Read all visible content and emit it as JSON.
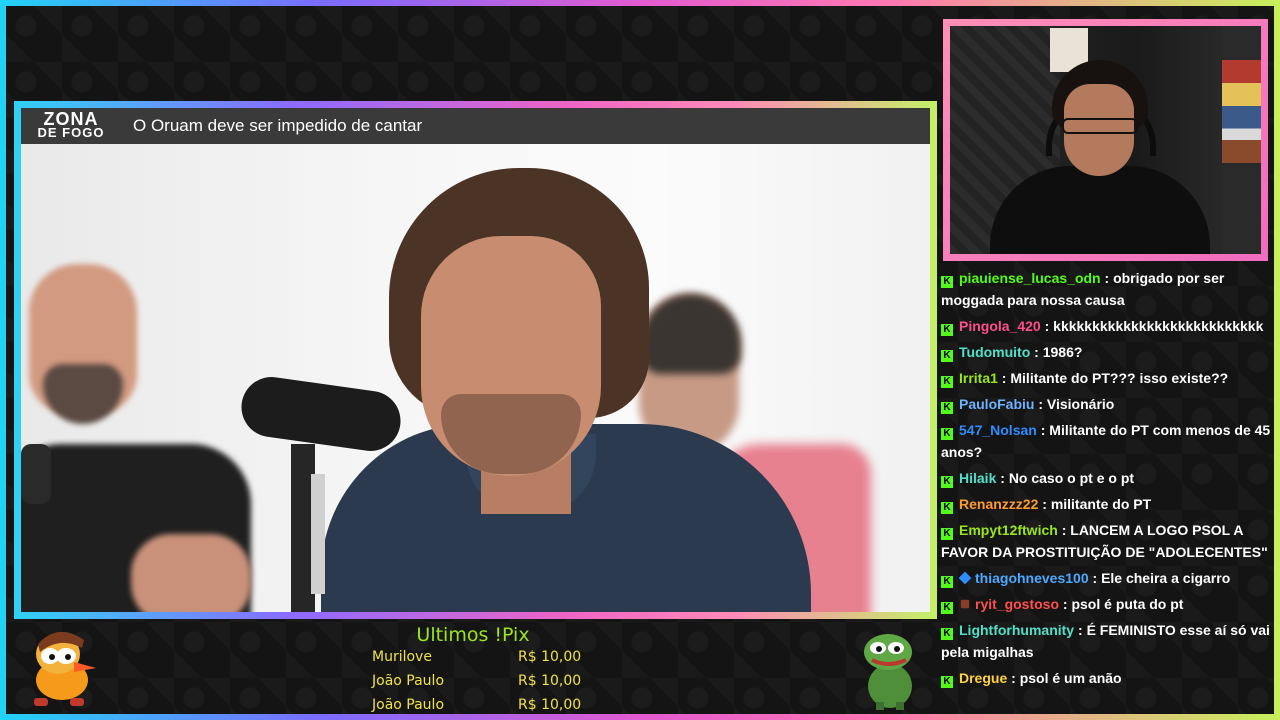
{
  "video": {
    "brand_line1": "ZONA",
    "brand_line2": "DE FOGO",
    "title": "O Oruam deve ser impedido de cantar"
  },
  "chat": {
    "messages": [
      {
        "user": "piauiense_lucas_odn",
        "user_color": "#53fc18",
        "badge_extra": null,
        "text": "obrigado por ser moggada para nossa causa"
      },
      {
        "user": "Pingola_420",
        "user_color": "#ff4f8b",
        "badge_extra": null,
        "text": "kkkkkkkkkkkkkkkkkkkkkkkkkkk"
      },
      {
        "user": "Tudomuito",
        "user_color": "#53e0c9",
        "badge_extra": null,
        "text": "1986?"
      },
      {
        "user": "Irrita1",
        "user_color": "#9be51f",
        "badge_extra": null,
        "text": "Militante do PT??? isso existe??"
      },
      {
        "user": "PauloFabiu",
        "user_color": "#6fb2ff",
        "badge_extra": null,
        "text": "Visionário"
      },
      {
        "user": "547_Nolsan",
        "user_color": "#2f8cff",
        "badge_extra": null,
        "text": "Militante do PT com menos de 45 anos?"
      },
      {
        "user": "Hilaik",
        "user_color": "#53e0c9",
        "badge_extra": null,
        "text": "No caso o pt e o pt"
      },
      {
        "user": "Renanzzz22",
        "user_color": "#ff9a2e",
        "badge_extra": null,
        "text": "militante do PT"
      },
      {
        "user": "Empyt12ftwich",
        "user_color": "#9be51f",
        "badge_extra": null,
        "text": "LANCEM A LOGO PSOL A FAVOR DA PROSTITUIÇÃO DE \"ADOLECENTES\""
      },
      {
        "user": "thiagohneves100",
        "user_color": "#4fa8ff",
        "badge_extra": "cube",
        "text": "Ele cheira a cigarro"
      },
      {
        "user": "ryit_gostoso",
        "user_color": "#ff4f4f",
        "badge_extra": "gift",
        "text": "psol é puta do pt"
      },
      {
        "user": "Lightforhumanity",
        "user_color": "#53e0c9",
        "badge_extra": null,
        "text": "É FEMINISTO esse aí só vai pela migalhas"
      },
      {
        "user": "Dregue",
        "user_color": "#ffd23f",
        "badge_extra": null,
        "text": "psol é um anão"
      }
    ]
  },
  "pix": {
    "title": "Ultimos !Pix",
    "rows": [
      {
        "name": "Murilove",
        "amount": "R$ 10,00"
      },
      {
        "name": "João Paulo",
        "amount": "R$ 10,00"
      },
      {
        "name": "João Paulo",
        "amount": "R$ 10,00"
      }
    ],
    "title_color": "#9be51f",
    "row_color": "#f0e24a"
  },
  "icons": {
    "kick_badge": "K",
    "mascot_left": "cartoon-duck-mascot-icon",
    "mascot_right": "pepe-frog-mascot-icon"
  }
}
